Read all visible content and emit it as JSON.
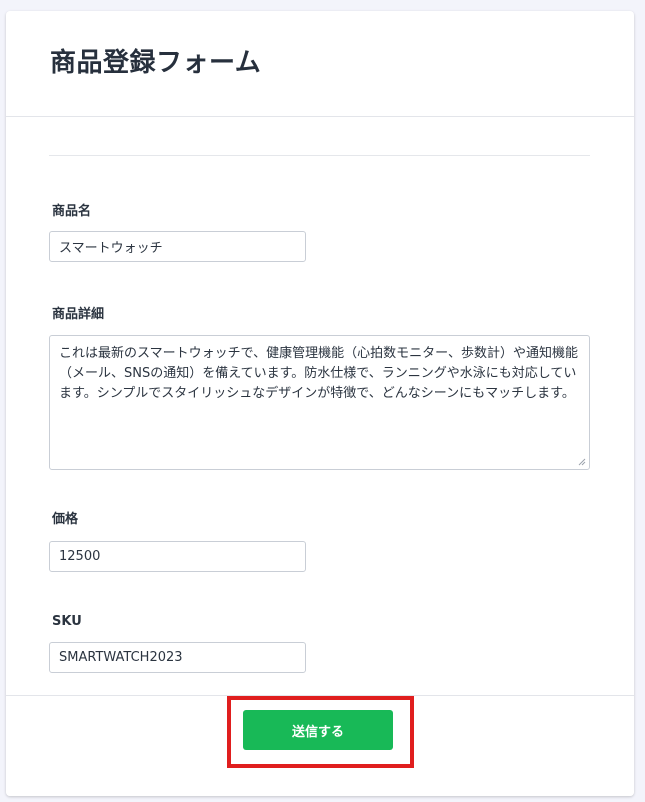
{
  "page": {
    "title": "商品登録フォーム"
  },
  "form": {
    "name": {
      "label": "商品名",
      "value": "スマートウォッチ"
    },
    "description": {
      "label": "商品詳細",
      "value": "これは最新のスマートウォッチで、健康管理機能（心拍数モニター、歩数計）や通知機能（メール、SNSの通知）を備えています。防水仕様で、ランニングや水泳にも対応しています。シンプルでスタイリッシュなデザインが特徴で、どんなシーンにもマッチします。"
    },
    "price": {
      "label": "価格",
      "value": "12500"
    },
    "sku": {
      "label": "SKU",
      "value": "SMARTWATCH2023"
    }
  },
  "footer": {
    "submit_label": "送信する"
  },
  "colors": {
    "accent": "#18b957",
    "highlight": "#e01e1e",
    "background": "#f3f4fb"
  }
}
